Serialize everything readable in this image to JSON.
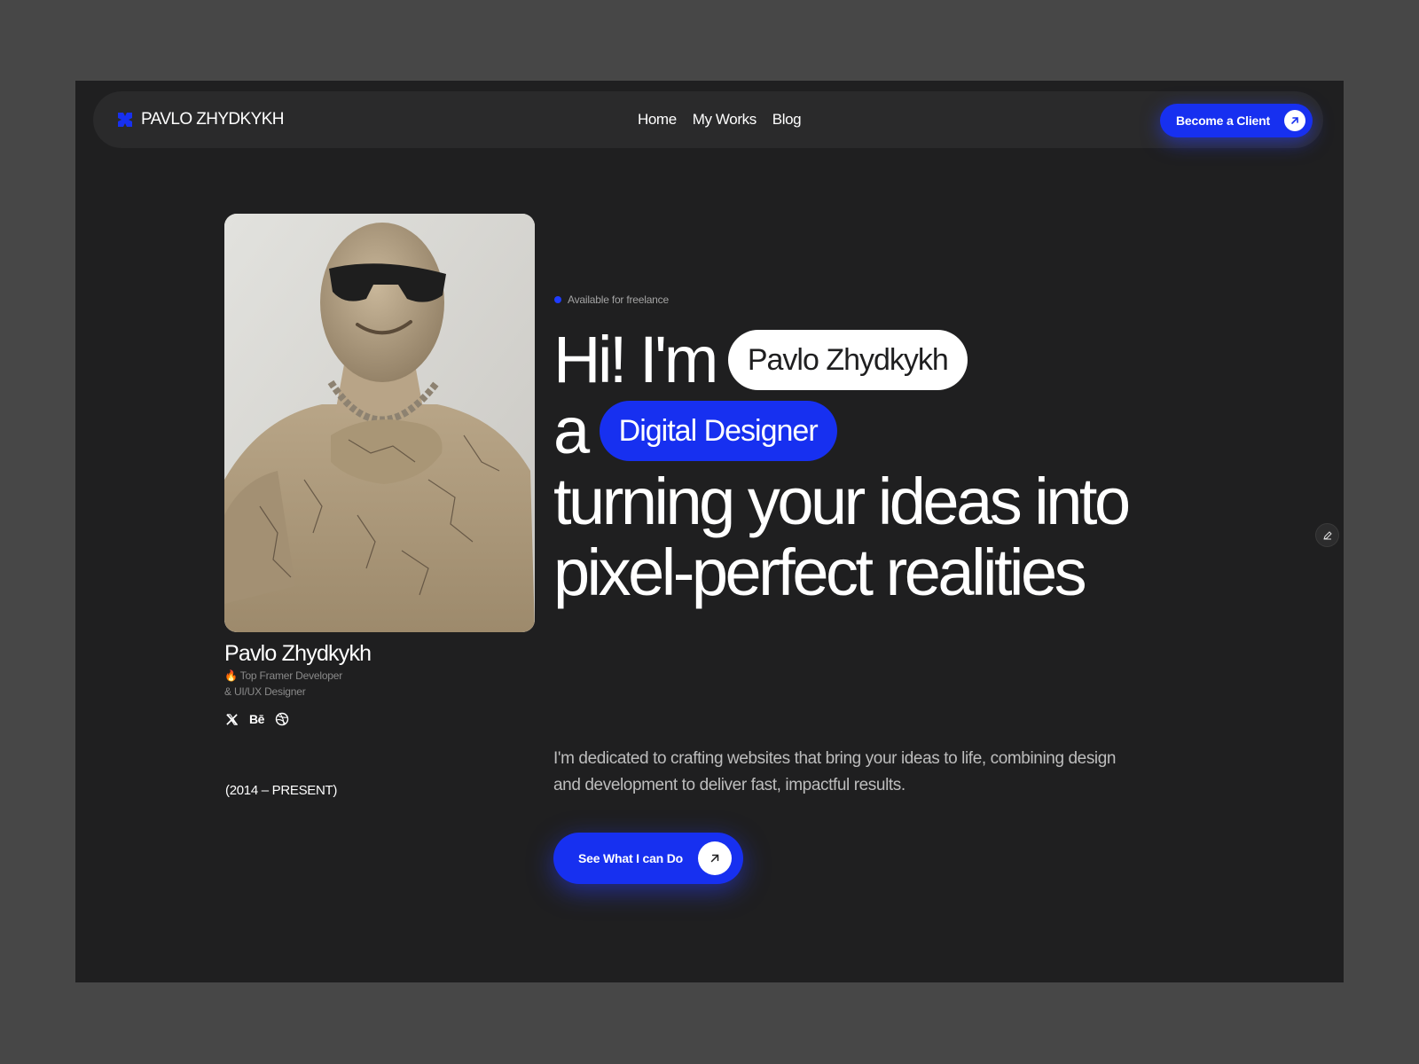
{
  "brand": {
    "name": "PAVLO ZHYDKYKH",
    "accent": "#1730f0"
  },
  "nav": {
    "links": [
      {
        "label": "Home"
      },
      {
        "label": "My Works"
      },
      {
        "label": "Blog"
      }
    ],
    "cta_label": "Become a Client",
    "cta_icon": "arrow-up-right-icon"
  },
  "profile": {
    "name": "Pavlo Zhydkykh",
    "role_line1": "🔥 Top Framer Developer",
    "role_line2": "& UI/UX Designer",
    "socials": [
      {
        "icon": "x-twitter-icon"
      },
      {
        "label": "Bē",
        "icon": "behance-icon"
      },
      {
        "icon": "dribbble-icon"
      }
    ],
    "years": "(2014 – PRESENT)"
  },
  "hero": {
    "status": "Available for freelance",
    "status_color": "#1f3cff",
    "line1_prefix": "Hi! I'm",
    "name_pill": "Pavlo Zhydkykh",
    "line2_prefix": "a",
    "role_pill": "Digital Designer",
    "line3": "turning your ideas into",
    "line4": "pixel-perfect realities",
    "description": "I'm dedicated to crafting websites that bring your ideas to life, combining design and development to deliver fast, impactful results.",
    "cta_label": "See What I can Do",
    "cta_icon": "arrow-up-right-icon"
  },
  "colors": {
    "page_bg": "#474747",
    "frame_bg": "#1f1f20",
    "nav_bg": "#2a2a2b",
    "blue": "#1730f0"
  }
}
